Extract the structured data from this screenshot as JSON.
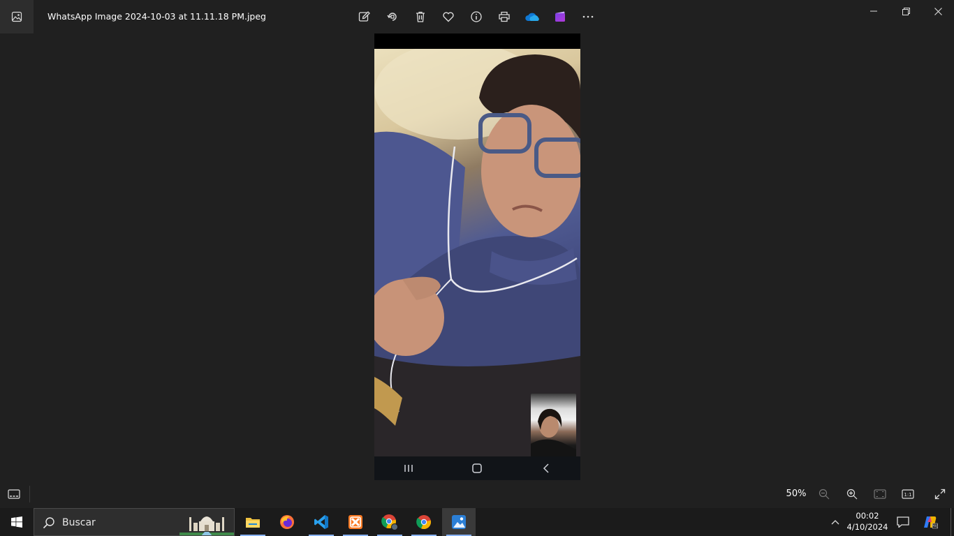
{
  "window": {
    "title": "WhatsApp Image 2024-10-03 at 11.11.18 PM.jpeg",
    "toolbar_icons": [
      "edit-image-icon",
      "rotate-icon",
      "delete-icon",
      "favorite-heart-icon",
      "info-icon",
      "print-icon",
      "onedrive-cloud-icon",
      "clipchamp-icon",
      "more-options-icon"
    ],
    "controls": [
      "minimize-icon",
      "restore-icon",
      "close-icon"
    ]
  },
  "bottom_bar": {
    "zoom_level": "50%",
    "icons": [
      "filmstrip-icon",
      "zoom-out-icon",
      "zoom-in-icon",
      "fit-to-window-icon",
      "actual-size-icon",
      "fullscreen-icon"
    ]
  },
  "taskbar": {
    "search_placeholder": "Buscar",
    "apps": [
      "file-explorer-icon",
      "firefox-icon",
      "vscode-icon",
      "xampp-icon",
      "chrome-profile-icon",
      "chrome-icon",
      "photos-icon"
    ],
    "clock_time": "00:02",
    "clock_date": "4/10/2024"
  },
  "colors": {
    "window_bg": "#202020",
    "taskbar_bg": "#1b1b1b",
    "accent": "#0078d4"
  }
}
